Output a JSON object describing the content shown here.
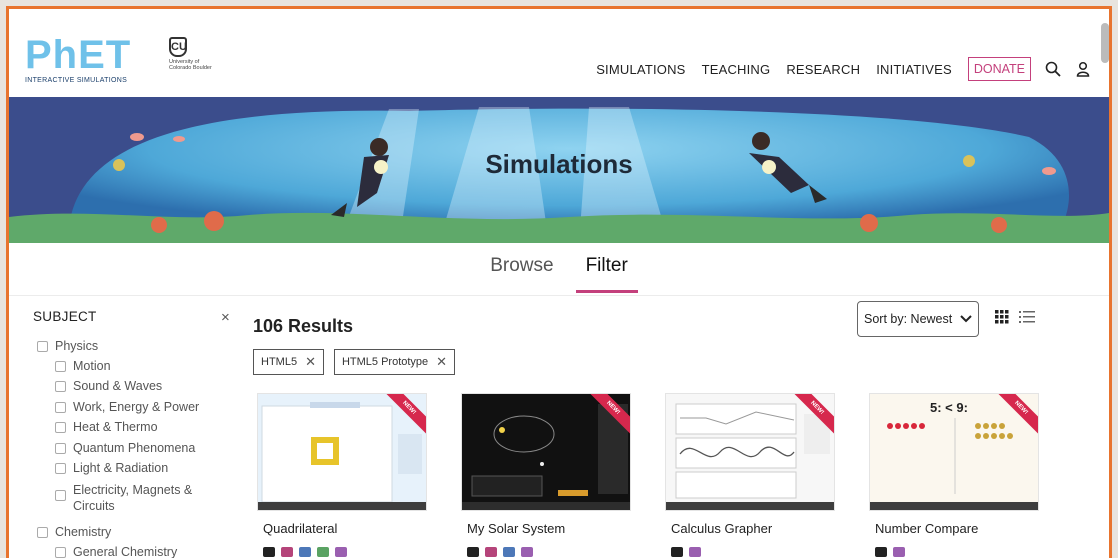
{
  "logo": {
    "text": "PhET",
    "subtitle": "INTERACTIVE SIMULATIONS"
  },
  "university": {
    "text": "University of Colorado Boulder"
  },
  "nav": {
    "items": [
      "SIMULATIONS",
      "TEACHING",
      "RESEARCH",
      "INITIATIVES"
    ],
    "donate": "DONATE",
    "icons": [
      "search-icon",
      "user-icon"
    ]
  },
  "banner": {
    "title": "Simulations"
  },
  "tabs": {
    "browse": "Browse",
    "filter": "Filter",
    "active": "Filter"
  },
  "sidebar": {
    "heading": "SUBJECT",
    "close": "×",
    "items": [
      {
        "label": "Physics",
        "level": 0
      },
      {
        "label": "Motion",
        "level": 1
      },
      {
        "label": "Sound & Waves",
        "level": 1
      },
      {
        "label": "Work, Energy & Power",
        "level": 1
      },
      {
        "label": "Heat & Thermo",
        "level": 1
      },
      {
        "label": "Quantum Phenomena",
        "level": 1
      },
      {
        "label": "Light & Radiation",
        "level": 1
      },
      {
        "label": "Electricity, Magnets &",
        "label2": "Circuits",
        "level": 1
      },
      {
        "label": "Chemistry",
        "level": 0
      },
      {
        "label": "General Chemistry",
        "level": 1
      }
    ]
  },
  "results": {
    "count": "106 Results",
    "chips": [
      {
        "label": "HTML5"
      },
      {
        "label": "HTML5 Prototype"
      }
    ],
    "sort": "Sort by: Newest"
  },
  "cards": [
    {
      "title": "Quadrilateral",
      "ribbon": "NEW!"
    },
    {
      "title": "My Solar System",
      "ribbon": "NEW!"
    },
    {
      "title": "Calculus Grapher",
      "ribbon": "NEW!"
    },
    {
      "title": "Number Compare",
      "ribbon": "NEW!"
    }
  ],
  "colors": {
    "accent": "#c4407c",
    "ribbon": "#d6284d",
    "frame": "#e8742e"
  }
}
